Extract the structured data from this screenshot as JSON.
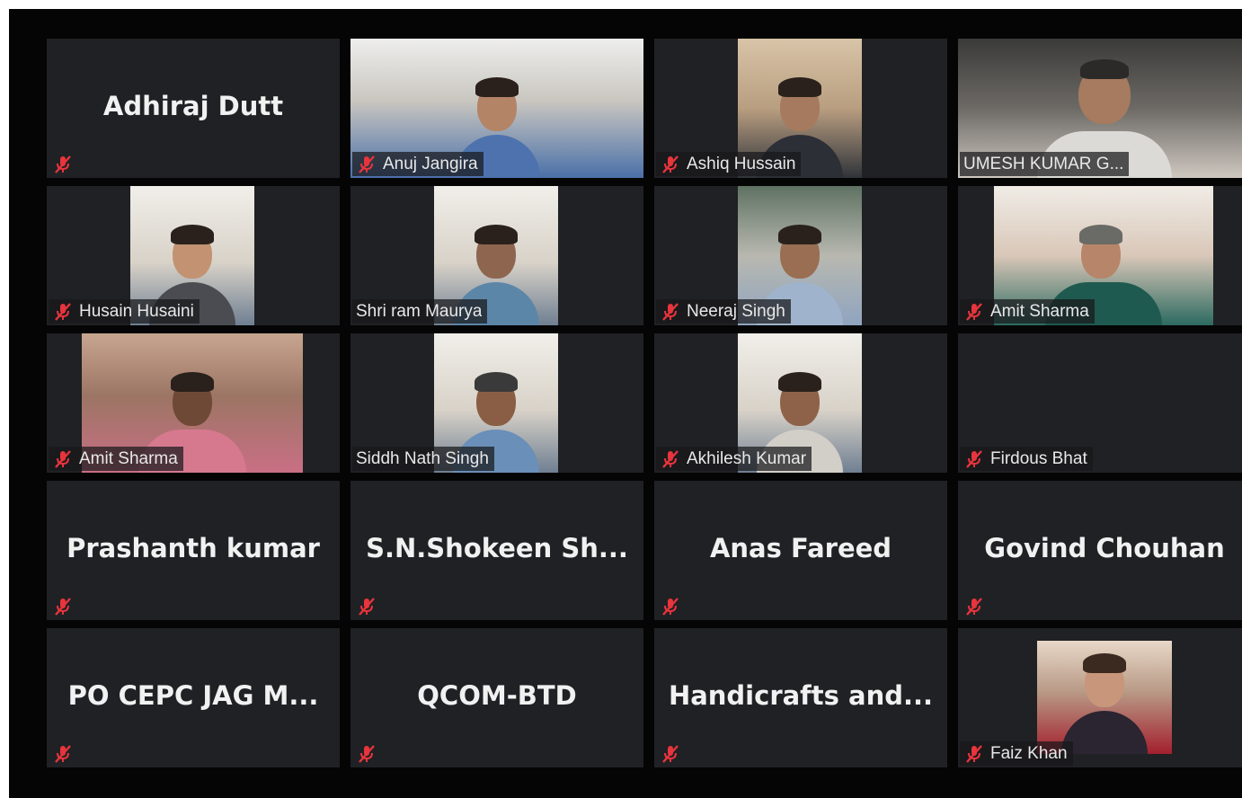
{
  "colors": {
    "tile_background": "#202124",
    "muted_icon": "#e8343c",
    "name_text": "#f1f1f1"
  },
  "participants": [
    {
      "name": "Adhiraj Dutt",
      "video": false,
      "muted": true
    },
    {
      "name": "Anuj Jangira",
      "video": true,
      "muted": true
    },
    {
      "name": "Ashiq Hussain",
      "video": true,
      "muted": true
    },
    {
      "name": "UMESH KUMAR G...",
      "video": true,
      "muted": false
    },
    {
      "name": "Husain Husaini",
      "video": true,
      "muted": true
    },
    {
      "name": "Shri ram Maurya",
      "video": true,
      "muted": false
    },
    {
      "name": "Neeraj Singh",
      "video": true,
      "muted": true
    },
    {
      "name": "Amit Sharma",
      "video": true,
      "muted": true
    },
    {
      "name": "Amit Sharma",
      "video": true,
      "muted": true
    },
    {
      "name": "Siddh Nath Singh",
      "video": true,
      "muted": false
    },
    {
      "name": "Akhilesh Kumar",
      "video": true,
      "muted": true
    },
    {
      "name": "Firdous Bhat",
      "video": false,
      "muted": true
    },
    {
      "name": "Prashanth kumar",
      "video": false,
      "muted": true
    },
    {
      "name": "S.N.Shokeen  Sh...",
      "video": false,
      "muted": true
    },
    {
      "name": "Anas Fareed",
      "video": false,
      "muted": true
    },
    {
      "name": "Govind Chouhan",
      "video": false,
      "muted": true
    },
    {
      "name": "PO  CEPC  JAG  M...",
      "video": false,
      "muted": true
    },
    {
      "name": "QCOM-BTD",
      "video": false,
      "muted": true
    },
    {
      "name": "Handicrafts  and...",
      "video": false,
      "muted": true
    },
    {
      "name": "Faiz Khan",
      "video": true,
      "muted": true
    }
  ]
}
